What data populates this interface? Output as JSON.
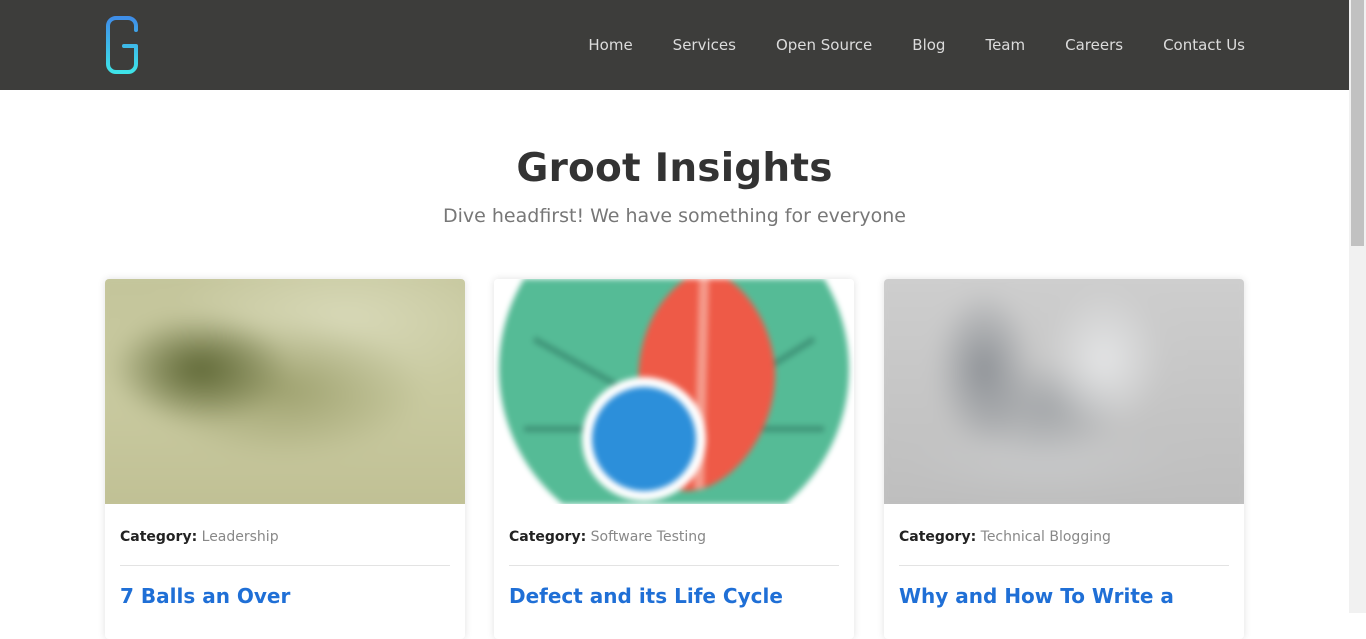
{
  "header": {
    "logo_icon": "groot-g-logo-icon",
    "nav": [
      {
        "label": "Home"
      },
      {
        "label": "Services"
      },
      {
        "label": "Open Source"
      },
      {
        "label": "Blog"
      },
      {
        "label": "Team"
      },
      {
        "label": "Careers"
      },
      {
        "label": "Contact Us"
      }
    ]
  },
  "hero": {
    "title": "Groot Insights",
    "subtitle": "Dive headfirst! We have something for everyone"
  },
  "cards": [
    {
      "category_label": "Category:",
      "category": "Leadership",
      "title": "7 Balls an Over"
    },
    {
      "category_label": "Category:",
      "category": "Software Testing",
      "title": "Defect and its Life Cycle"
    },
    {
      "category_label": "Category:",
      "category": "Technical Blogging",
      "title": "Why and How To Write a"
    }
  ],
  "colors": {
    "nav_bg": "#3d3d3b",
    "link": "#1f6fd6",
    "logo_gradient_top": "#3f8ee8",
    "logo_gradient_bottom": "#3ee3e8"
  }
}
